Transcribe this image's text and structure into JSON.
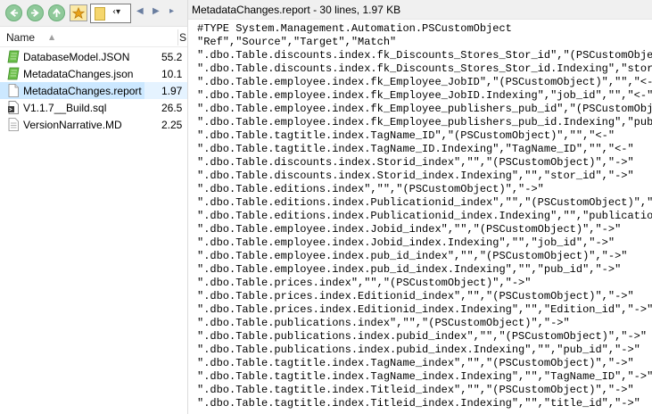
{
  "toolbar": {
    "back_icon": "back-arrow-icon",
    "forward_icon": "forward-arrow-icon",
    "up_icon": "up-arrow-icon",
    "favorites_icon": "folder-star-icon",
    "address_chevron": "‹▾",
    "nav_left": "◀",
    "nav_right": "▶",
    "nav_extra": "▸"
  },
  "file_list": {
    "col_name": "Name",
    "col_size": "S",
    "files": [
      {
        "name": "DatabaseModel.JSON",
        "size": "55.2",
        "icon": "green-json-icon",
        "selected": false
      },
      {
        "name": "MetadataChanges.json",
        "size": "10.1",
        "icon": "green-json-icon",
        "selected": false
      },
      {
        "name": "MetadataChanges.report",
        "size": "1.97",
        "icon": "blank-document-icon",
        "selected": true
      },
      {
        "name": "V1.1.7__Build.sql",
        "size": "26.5",
        "icon": "sql-script-icon",
        "selected": false
      },
      {
        "name": "VersionNarrative.MD",
        "size": "2.25",
        "icon": "text-document-icon",
        "selected": false
      }
    ]
  },
  "preview": {
    "title": "MetadataChanges.report - 30 lines, 1.97 KB",
    "lines": [
      "#TYPE System.Management.Automation.PSCustomObject",
      "\"Ref\",\"Source\",\"Target\",\"Match\"",
      "\".dbo.Table.discounts.index.fk_Discounts_Stores_Stor_id\",\"(PSCustomObject)\",\"\",\"<-\"",
      "\".dbo.Table.discounts.index.fk_Discounts_Stores_Stor_id.Indexing\",\"stor_id\",\"\",\"<-\"",
      "\".dbo.Table.employee.index.fk_Employee_JobID\",\"(PSCustomObject)\",\"\",\"<-\"",
      "\".dbo.Table.employee.index.fk_Employee_JobID.Indexing\",\"job_id\",\"\",\"<-\"",
      "\".dbo.Table.employee.index.fk_Employee_publishers_pub_id\",\"(PSCustomObject)\",\"\",\"<-\"",
      "\".dbo.Table.employee.index.fk_Employee_publishers_pub_id.Indexing\",\"pub_id\",\"\",\"<-\"",
      "\".dbo.Table.tagtitle.index.TagName_ID\",\"(PSCustomObject)\",\"\",\"<-\"",
      "\".dbo.Table.tagtitle.index.TagName_ID.Indexing\",\"TagName_ID\",\"\",\"<-\"",
      "\".dbo.Table.discounts.index.Storid_index\",\"\",\"(PSCustomObject)\",\"->\"",
      "\".dbo.Table.discounts.index.Storid_index.Indexing\",\"\",\"stor_id\",\"->\"",
      "\".dbo.Table.editions.index\",\"\",\"(PSCustomObject)\",\"->\"",
      "\".dbo.Table.editions.index.Publicationid_index\",\"\",\"(PSCustomObject)\",\"->\"",
      "\".dbo.Table.editions.index.Publicationid_index.Indexing\",\"\",\"publication_id\",\"->\"",
      "\".dbo.Table.employee.index.Jobid_index\",\"\",\"(PSCustomObject)\",\"->\"",
      "\".dbo.Table.employee.index.Jobid_index.Indexing\",\"\",\"job_id\",\"->\"",
      "\".dbo.Table.employee.index.pub_id_index\",\"\",\"(PSCustomObject)\",\"->\"",
      "\".dbo.Table.employee.index.pub_id_index.Indexing\",\"\",\"pub_id\",\"->\"",
      "\".dbo.Table.prices.index\",\"\",\"(PSCustomObject)\",\"->\"",
      "\".dbo.Table.prices.index.Editionid_index\",\"\",\"(PSCustomObject)\",\"->\"",
      "\".dbo.Table.prices.index.Editionid_index.Indexing\",\"\",\"Edition_id\",\"->\"",
      "\".dbo.Table.publications.index\",\"\",\"(PSCustomObject)\",\"->\"",
      "\".dbo.Table.publications.index.pubid_index\",\"\",\"(PSCustomObject)\",\"->\"",
      "\".dbo.Table.publications.index.pubid_index.Indexing\",\"\",\"pub_id\",\"->\"",
      "\".dbo.Table.tagtitle.index.TagName_index\",\"\",\"(PSCustomObject)\",\"->\"",
      "\".dbo.Table.tagtitle.index.TagName_index.Indexing\",\"\",\"TagName_ID\",\"->\"",
      "\".dbo.Table.tagtitle.index.Titleid_index\",\"\",\"(PSCustomObject)\",\"->\"",
      "\".dbo.Table.tagtitle.index.Titleid_index.Indexing\",\"\",\"title_id\",\"->\""
    ]
  }
}
